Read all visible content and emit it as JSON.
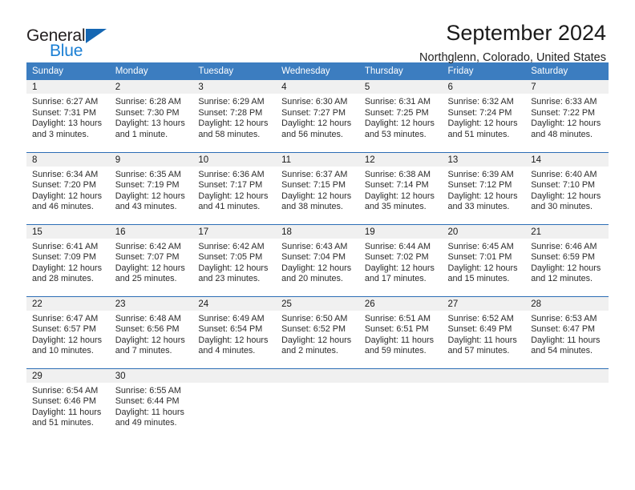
{
  "brand": {
    "name_part1": "General",
    "name_part2": "Blue",
    "logo_icon": "triangle-flag-icon"
  },
  "header": {
    "title": "September 2024",
    "location": "Northglenn, Colorado, United States"
  },
  "colors": {
    "header_row": "#3c7dc0",
    "row_divider": "#2c6db5",
    "daynum_bg": "#f0f0f0",
    "brand_blue": "#1a7fd4",
    "logo_blue": "#1567b3"
  },
  "calendar": {
    "weekday_headers": [
      "Sunday",
      "Monday",
      "Tuesday",
      "Wednesday",
      "Thursday",
      "Friday",
      "Saturday"
    ],
    "weeks": [
      [
        {
          "day": "1",
          "sunrise": "Sunrise: 6:27 AM",
          "sunset": "Sunset: 7:31 PM",
          "daylight_1": "Daylight: 13 hours",
          "daylight_2": "and 3 minutes."
        },
        {
          "day": "2",
          "sunrise": "Sunrise: 6:28 AM",
          "sunset": "Sunset: 7:30 PM",
          "daylight_1": "Daylight: 13 hours",
          "daylight_2": "and 1 minute."
        },
        {
          "day": "3",
          "sunrise": "Sunrise: 6:29 AM",
          "sunset": "Sunset: 7:28 PM",
          "daylight_1": "Daylight: 12 hours",
          "daylight_2": "and 58 minutes."
        },
        {
          "day": "4",
          "sunrise": "Sunrise: 6:30 AM",
          "sunset": "Sunset: 7:27 PM",
          "daylight_1": "Daylight: 12 hours",
          "daylight_2": "and 56 minutes."
        },
        {
          "day": "5",
          "sunrise": "Sunrise: 6:31 AM",
          "sunset": "Sunset: 7:25 PM",
          "daylight_1": "Daylight: 12 hours",
          "daylight_2": "and 53 minutes."
        },
        {
          "day": "6",
          "sunrise": "Sunrise: 6:32 AM",
          "sunset": "Sunset: 7:24 PM",
          "daylight_1": "Daylight: 12 hours",
          "daylight_2": "and 51 minutes."
        },
        {
          "day": "7",
          "sunrise": "Sunrise: 6:33 AM",
          "sunset": "Sunset: 7:22 PM",
          "daylight_1": "Daylight: 12 hours",
          "daylight_2": "and 48 minutes."
        }
      ],
      [
        {
          "day": "8",
          "sunrise": "Sunrise: 6:34 AM",
          "sunset": "Sunset: 7:20 PM",
          "daylight_1": "Daylight: 12 hours",
          "daylight_2": "and 46 minutes."
        },
        {
          "day": "9",
          "sunrise": "Sunrise: 6:35 AM",
          "sunset": "Sunset: 7:19 PM",
          "daylight_1": "Daylight: 12 hours",
          "daylight_2": "and 43 minutes."
        },
        {
          "day": "10",
          "sunrise": "Sunrise: 6:36 AM",
          "sunset": "Sunset: 7:17 PM",
          "daylight_1": "Daylight: 12 hours",
          "daylight_2": "and 41 minutes."
        },
        {
          "day": "11",
          "sunrise": "Sunrise: 6:37 AM",
          "sunset": "Sunset: 7:15 PM",
          "daylight_1": "Daylight: 12 hours",
          "daylight_2": "and 38 minutes."
        },
        {
          "day": "12",
          "sunrise": "Sunrise: 6:38 AM",
          "sunset": "Sunset: 7:14 PM",
          "daylight_1": "Daylight: 12 hours",
          "daylight_2": "and 35 minutes."
        },
        {
          "day": "13",
          "sunrise": "Sunrise: 6:39 AM",
          "sunset": "Sunset: 7:12 PM",
          "daylight_1": "Daylight: 12 hours",
          "daylight_2": "and 33 minutes."
        },
        {
          "day": "14",
          "sunrise": "Sunrise: 6:40 AM",
          "sunset": "Sunset: 7:10 PM",
          "daylight_1": "Daylight: 12 hours",
          "daylight_2": "and 30 minutes."
        }
      ],
      [
        {
          "day": "15",
          "sunrise": "Sunrise: 6:41 AM",
          "sunset": "Sunset: 7:09 PM",
          "daylight_1": "Daylight: 12 hours",
          "daylight_2": "and 28 minutes."
        },
        {
          "day": "16",
          "sunrise": "Sunrise: 6:42 AM",
          "sunset": "Sunset: 7:07 PM",
          "daylight_1": "Daylight: 12 hours",
          "daylight_2": "and 25 minutes."
        },
        {
          "day": "17",
          "sunrise": "Sunrise: 6:42 AM",
          "sunset": "Sunset: 7:05 PM",
          "daylight_1": "Daylight: 12 hours",
          "daylight_2": "and 23 minutes."
        },
        {
          "day": "18",
          "sunrise": "Sunrise: 6:43 AM",
          "sunset": "Sunset: 7:04 PM",
          "daylight_1": "Daylight: 12 hours",
          "daylight_2": "and 20 minutes."
        },
        {
          "day": "19",
          "sunrise": "Sunrise: 6:44 AM",
          "sunset": "Sunset: 7:02 PM",
          "daylight_1": "Daylight: 12 hours",
          "daylight_2": "and 17 minutes."
        },
        {
          "day": "20",
          "sunrise": "Sunrise: 6:45 AM",
          "sunset": "Sunset: 7:01 PM",
          "daylight_1": "Daylight: 12 hours",
          "daylight_2": "and 15 minutes."
        },
        {
          "day": "21",
          "sunrise": "Sunrise: 6:46 AM",
          "sunset": "Sunset: 6:59 PM",
          "daylight_1": "Daylight: 12 hours",
          "daylight_2": "and 12 minutes."
        }
      ],
      [
        {
          "day": "22",
          "sunrise": "Sunrise: 6:47 AM",
          "sunset": "Sunset: 6:57 PM",
          "daylight_1": "Daylight: 12 hours",
          "daylight_2": "and 10 minutes."
        },
        {
          "day": "23",
          "sunrise": "Sunrise: 6:48 AM",
          "sunset": "Sunset: 6:56 PM",
          "daylight_1": "Daylight: 12 hours",
          "daylight_2": "and 7 minutes."
        },
        {
          "day": "24",
          "sunrise": "Sunrise: 6:49 AM",
          "sunset": "Sunset: 6:54 PM",
          "daylight_1": "Daylight: 12 hours",
          "daylight_2": "and 4 minutes."
        },
        {
          "day": "25",
          "sunrise": "Sunrise: 6:50 AM",
          "sunset": "Sunset: 6:52 PM",
          "daylight_1": "Daylight: 12 hours",
          "daylight_2": "and 2 minutes."
        },
        {
          "day": "26",
          "sunrise": "Sunrise: 6:51 AM",
          "sunset": "Sunset: 6:51 PM",
          "daylight_1": "Daylight: 11 hours",
          "daylight_2": "and 59 minutes."
        },
        {
          "day": "27",
          "sunrise": "Sunrise: 6:52 AM",
          "sunset": "Sunset: 6:49 PM",
          "daylight_1": "Daylight: 11 hours",
          "daylight_2": "and 57 minutes."
        },
        {
          "day": "28",
          "sunrise": "Sunrise: 6:53 AM",
          "sunset": "Sunset: 6:47 PM",
          "daylight_1": "Daylight: 11 hours",
          "daylight_2": "and 54 minutes."
        }
      ],
      [
        {
          "day": "29",
          "sunrise": "Sunrise: 6:54 AM",
          "sunset": "Sunset: 6:46 PM",
          "daylight_1": "Daylight: 11 hours",
          "daylight_2": "and 51 minutes."
        },
        {
          "day": "30",
          "sunrise": "Sunrise: 6:55 AM",
          "sunset": "Sunset: 6:44 PM",
          "daylight_1": "Daylight: 11 hours",
          "daylight_2": "and 49 minutes."
        },
        {
          "day": "",
          "sunrise": "",
          "sunset": "",
          "daylight_1": "",
          "daylight_2": ""
        },
        {
          "day": "",
          "sunrise": "",
          "sunset": "",
          "daylight_1": "",
          "daylight_2": ""
        },
        {
          "day": "",
          "sunrise": "",
          "sunset": "",
          "daylight_1": "",
          "daylight_2": ""
        },
        {
          "day": "",
          "sunrise": "",
          "sunset": "",
          "daylight_1": "",
          "daylight_2": ""
        },
        {
          "day": "",
          "sunrise": "",
          "sunset": "",
          "daylight_1": "",
          "daylight_2": ""
        }
      ]
    ]
  }
}
